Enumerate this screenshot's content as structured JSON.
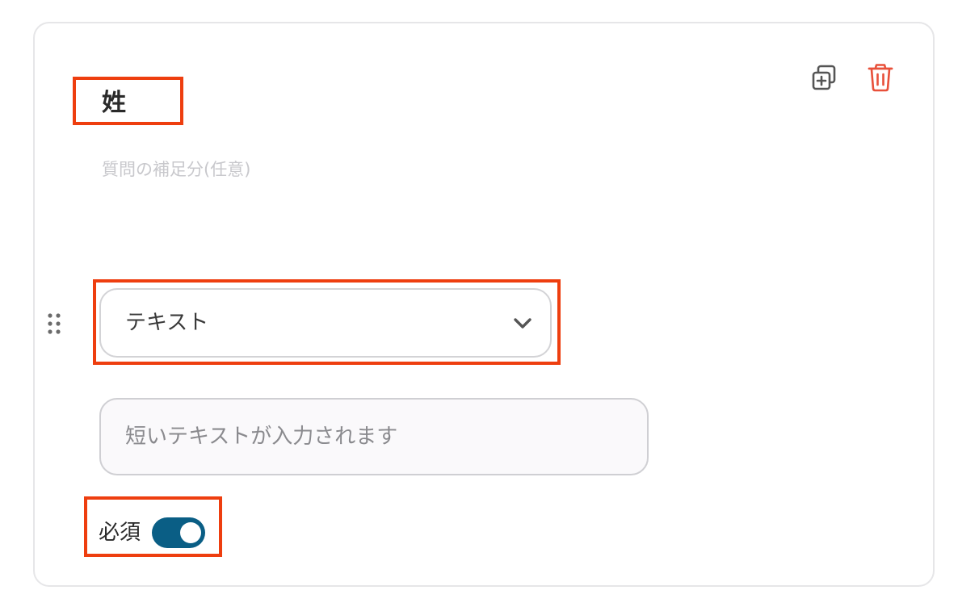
{
  "question": {
    "title": "姓",
    "description_placeholder": "質問の補足分(任意)"
  },
  "type_select": {
    "value": "テキスト"
  },
  "answer_preview": {
    "placeholder": "短いテキストが入力されます"
  },
  "required": {
    "label": "必須",
    "enabled": true
  },
  "icons": {
    "duplicate": "duplicate-icon",
    "delete": "trash-icon",
    "drag": "drag-handle-icon",
    "chevron": "chevron-down-icon"
  },
  "colors": {
    "toggle_on": "#0a5e85",
    "delete_icon": "#e8503a",
    "annotation": "#ee3e0f"
  }
}
